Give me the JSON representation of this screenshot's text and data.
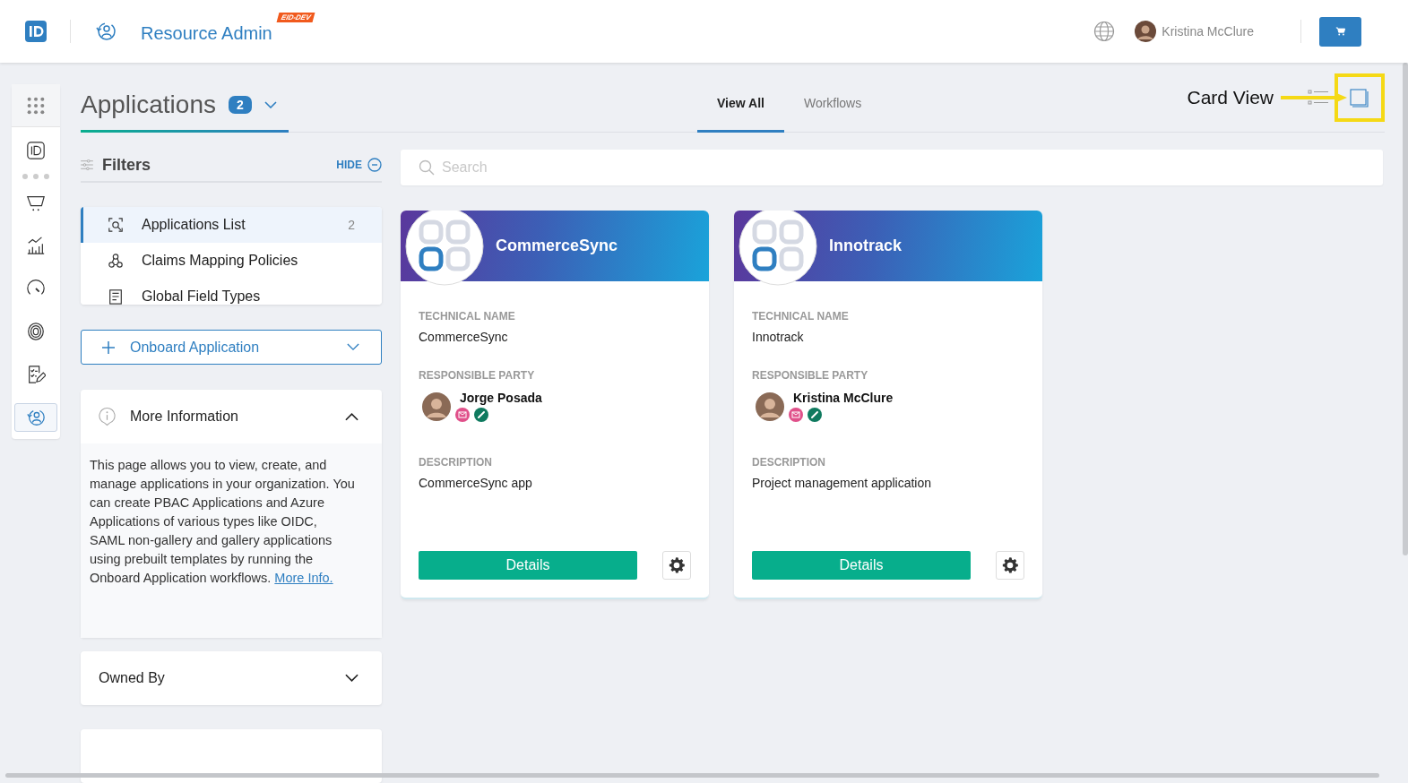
{
  "header": {
    "app_name": "Resource Admin",
    "env_badge": "EID-DEV",
    "user_name": "Kristina McClure"
  },
  "rail": [
    {
      "kind": "grid",
      "selected": false
    },
    {
      "kind": "id",
      "selected": false
    },
    {
      "kind": "cart",
      "selected": false
    },
    {
      "kind": "chart",
      "selected": false
    },
    {
      "kind": "gauge",
      "selected": false
    },
    {
      "kind": "fingerprint",
      "selected": false
    },
    {
      "kind": "checklist",
      "selected": false
    },
    {
      "kind": "resource",
      "selected": true
    }
  ],
  "page": {
    "title": "Applications",
    "count": "2"
  },
  "tabs": [
    {
      "label": "View All",
      "selected": true
    },
    {
      "label": "Workflows",
      "selected": false
    }
  ],
  "annotation": {
    "label": "Card View"
  },
  "view_toggle": [
    {
      "kind": "list",
      "selected": false
    },
    {
      "kind": "card",
      "selected": true
    }
  ],
  "filters": {
    "title": "Filters",
    "hide_label": "HIDE",
    "items": [
      {
        "kind": "scan",
        "label": "Applications List",
        "count": "2",
        "selected": true
      },
      {
        "kind": "network",
        "label": "Claims Mapping Policies",
        "selected": false
      },
      {
        "kind": "form",
        "label": "Global Field Types",
        "selected": false
      }
    ]
  },
  "onboard_button": {
    "label": "Onboard Application"
  },
  "more_info": {
    "title": "More Information",
    "expanded": true,
    "text": "This page allows you to view, create, and manage applications in your organization. You can create PBAC Applications and Azure Applications of various types like OIDC, SAML non-gallery and gallery applications using prebuilt templates by running the Onboard Application workflows.",
    "link": "More Info."
  },
  "owned_by": {
    "title": "Owned By",
    "expanded": false
  },
  "search": {
    "placeholder": "Search"
  },
  "cards": [
    {
      "name": "CommerceSync",
      "technical_name_label": "TECHNICAL NAME",
      "technical_name": "CommerceSync",
      "party_label": "RESPONSIBLE PARTY",
      "party_name": "Jorge Posada",
      "description_label": "DESCRIPTION",
      "description": "CommerceSync app",
      "button": "Details"
    },
    {
      "name": "Innotrack",
      "technical_name_label": "TECHNICAL NAME",
      "technical_name": "Innotrack",
      "party_label": "RESPONSIBLE PARTY",
      "party_name": "Kristina McClure",
      "description_label": "DESCRIPTION",
      "description": "Project management application",
      "button": "Details"
    }
  ]
}
